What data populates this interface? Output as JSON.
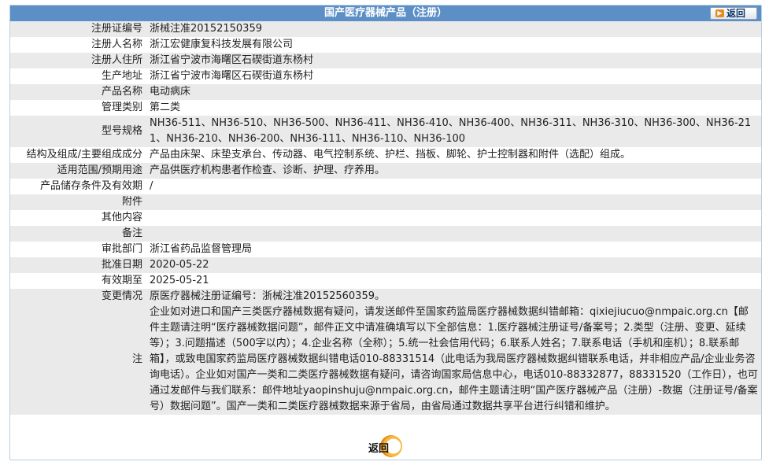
{
  "header": {
    "title": "国产医疗器械产品（注册）",
    "back_label": "返回"
  },
  "rows": [
    {
      "label": "注册证编号",
      "value": "浙械注准20152150359"
    },
    {
      "label": "注册人名称",
      "value": "浙江宏健康复科技发展有限公司"
    },
    {
      "label": "注册人住所",
      "value": "浙江省宁波市海曙区石碶街道东杨村"
    },
    {
      "label": "生产地址",
      "value": "浙江省宁波市海曙区石碶街道东杨村"
    },
    {
      "label": "产品名称",
      "value": "电动病床"
    },
    {
      "label": "管理类别",
      "value": "第二类"
    },
    {
      "label": "型号规格",
      "value": "NH36-511、NH36-510、NH36-500、NH36-411、NH36-410、NH36-400、NH36-311、NH36-310、NH36-300、NH36-211、NH36-210、NH36-200、NH36-111、NH36-110、NH36-100"
    },
    {
      "label": "结构及组成/主要组成成分",
      "value": "产品由床架、床垫支承台、传动器、电气控制系统、护栏、挡板、脚轮、护士控制器和附件（选配）组成。"
    },
    {
      "label": "适用范围/预期用途",
      "value": "产品供医疗机构患者作检查、诊断、护理、疗养用。"
    },
    {
      "label": "产品储存条件及有效期",
      "value": "/"
    },
    {
      "label": "附件",
      "value": ""
    },
    {
      "label": "其他内容",
      "value": ""
    },
    {
      "label": "备注",
      "value": ""
    },
    {
      "label": "审批部门",
      "value": "浙江省药品监督管理局"
    },
    {
      "label": "批准日期",
      "value": "2020-05-22"
    },
    {
      "label": "有效期至",
      "value": "2025-05-21"
    },
    {
      "label": "变更情况",
      "value": "原医疗器械注册证编号：浙械注准20152560359。"
    },
    {
      "label": "注",
      "value": "企业如对进口和国产三类医疗器械数据有疑问，请发送邮件至国家药监局医疗器械数据纠错邮箱：qixiejiucuo@nmpaic.org.cn【邮件主题请注明“医疗器械数据问题”，邮件正文中请准确填写以下全部信息：1.医疗器械注册证号/备案号；2.类型（注册、变更、延续等）；3.问题描述（500字以内）；4.企业名称（全称）；5.统一社会信用代码；6.联系人姓名；7.联系电话（手机和座机）；8.联系邮箱】，或致电国家药监局医疗器械数据纠错电话010-88331514（此电话为我局医疗器械数据纠错联系电话，并非相应产品/企业业务咨询电话）。企业如对国产一类和二类医疗器械数据有疑问，请咨询国家局信息中心，电话010-88332877，88331520（工作日），也可通过发邮件与我们联系：邮件地址yaopinshuju@nmpaic.org.cn，邮件主题请注明“国产医疗器械产品（注册）-数据（注册证号/备案号）数据问题”。国产一类和二类医疗器械数据来源于省局，由省局通过数据共享平台进行纠错和维护。"
    }
  ],
  "footer": {
    "back_label": "返回"
  },
  "colors": {
    "header_bg": "#5d8fc7",
    "row_odd_bg": "#eaeaea",
    "button_accent": "#e8891d"
  }
}
